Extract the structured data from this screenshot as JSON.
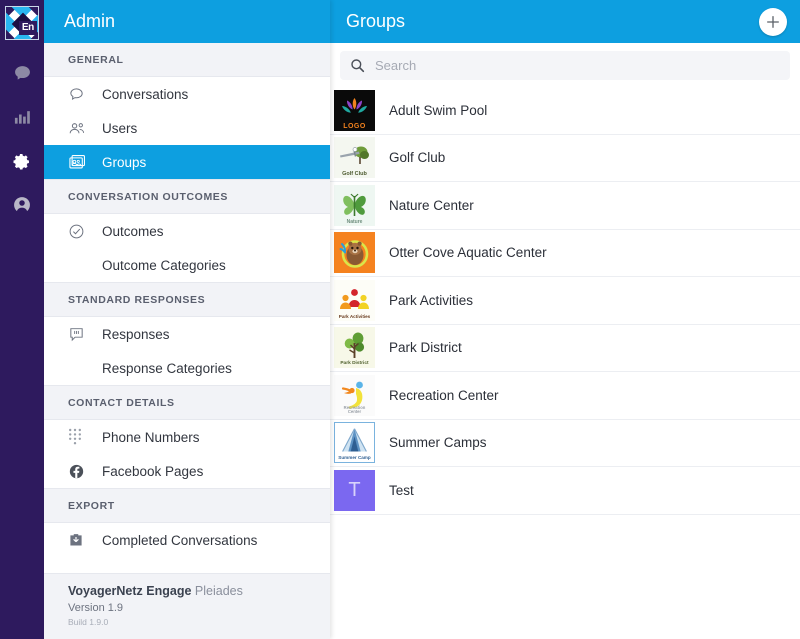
{
  "rail": {
    "logo": {
      "name": "engage-logo",
      "badge": "En"
    },
    "icons": [
      {
        "name": "conversations-icon",
        "label": "Conversations"
      },
      {
        "name": "reports-bar-chart-icon",
        "label": "Reports"
      },
      {
        "name": "settings-gear-icon",
        "label": "Settings"
      },
      {
        "name": "account-user-icon",
        "label": "Account"
      }
    ]
  },
  "sidebar": {
    "header": {
      "title": "Admin"
    },
    "sections": [
      {
        "title": "GENERAL",
        "items": [
          {
            "label": "Conversations",
            "icon": "conversation-bubble-icon",
            "sub": false,
            "active": false
          },
          {
            "label": "Users",
            "icon": "users-icon",
            "sub": false,
            "active": false
          },
          {
            "label": "Groups",
            "icon": "groups-card-icon",
            "sub": false,
            "active": true
          }
        ]
      },
      {
        "title": "CONVERSATION OUTCOMES",
        "items": [
          {
            "label": "Outcomes",
            "icon": "check-circle-icon",
            "sub": false,
            "active": false
          },
          {
            "label": "Outcome Categories",
            "icon": "",
            "sub": true,
            "active": false
          }
        ]
      },
      {
        "title": "STANDARD RESPONSES",
        "items": [
          {
            "label": "Responses",
            "icon": "quote-bubble-icon",
            "sub": false,
            "active": false
          },
          {
            "label": "Response Categories",
            "icon": "",
            "sub": true,
            "active": false
          }
        ]
      },
      {
        "title": "CONTACT DETAILS",
        "items": [
          {
            "label": "Phone Numbers",
            "icon": "dialpad-icon",
            "sub": false,
            "active": false
          },
          {
            "label": "Facebook Pages",
            "icon": "facebook-icon",
            "sub": false,
            "active": false
          }
        ]
      },
      {
        "title": "EXPORT",
        "items": [
          {
            "label": "Completed Conversations",
            "icon": "download-box-icon",
            "sub": false,
            "active": false
          }
        ]
      }
    ],
    "footer": {
      "product": "VoyagerNetz Engage",
      "edition": "Pleiades",
      "version": "Version 1.9",
      "build": "Build 1.9.0"
    }
  },
  "panel": {
    "header": {
      "title": "Groups",
      "add_button": "+"
    },
    "search": {
      "value": "",
      "placeholder": "Search",
      "icon": "search-icon"
    },
    "groups": [
      {
        "name": "Adult Swim Pool",
        "avatar": "lotus-logo-avatar"
      },
      {
        "name": "Golf Club",
        "avatar": "golf-club-avatar"
      },
      {
        "name": "Nature Center",
        "avatar": "butterfly-nature-avatar"
      },
      {
        "name": "Otter Cove Aquatic Center",
        "avatar": "otter-avatar"
      },
      {
        "name": "Park Activities",
        "avatar": "park-activities-people-avatar"
      },
      {
        "name": "Park District",
        "avatar": "park-district-tree-avatar"
      },
      {
        "name": "Recreation Center",
        "avatar": "recreation-center-avatar"
      },
      {
        "name": "Summer Camps",
        "avatar": "summer-camp-tent-avatar"
      },
      {
        "name": "Test",
        "avatar": "letter-t-avatar"
      }
    ]
  },
  "colors": {
    "accent_blue": "#0d9fe0",
    "rail_purple": "#2e1a5e",
    "section_bg": "#f2f3f7",
    "text_dark": "#32363f"
  }
}
